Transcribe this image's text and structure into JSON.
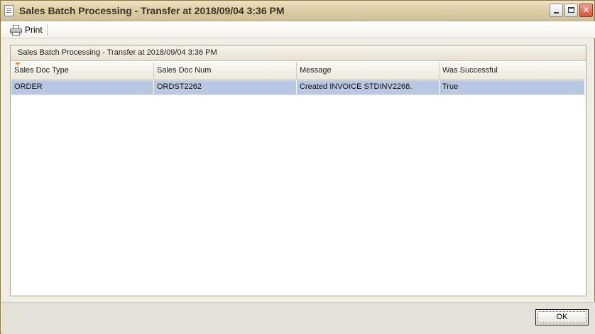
{
  "window": {
    "title": "Sales Batch Processing - Transfer at 2018/09/04 3:36 PM"
  },
  "toolbar": {
    "print_label": "Print"
  },
  "panel": {
    "title": "Sales Batch Processing - Transfer at 2018/09/04 3:36 PM"
  },
  "grid": {
    "columns": [
      "Sales Doc Type",
      "Sales Doc Num",
      "Message",
      "Was Successful"
    ],
    "rows": [
      [
        "ORDER",
        "ORDST2262",
        "Created INVOICE STDINV2268.",
        "True"
      ]
    ]
  },
  "footer": {
    "ok_label": "OK"
  },
  "colors": {
    "selected_row": "#b9c8e2",
    "titlebar": "#dccfa6"
  }
}
